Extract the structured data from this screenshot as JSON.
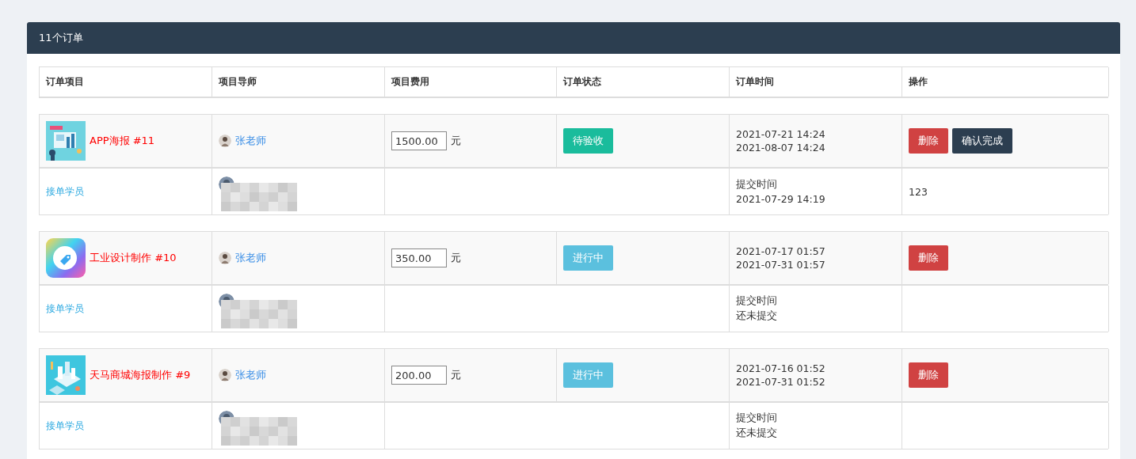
{
  "panel": {
    "title": "11个订单"
  },
  "table": {
    "columns": [
      "订单项目",
      "项目导师",
      "项目费用",
      "订单状态",
      "订单时间",
      "操作"
    ],
    "orders": [
      {
        "title": "APP海报 #11",
        "mentor": "张老师",
        "fee": "1500.00",
        "unit": "元",
        "status": {
          "kind": "pending",
          "label": "待验收"
        },
        "times": [
          "2021-07-21 14:24",
          "2021-08-07 14:24"
        ],
        "actions": [
          {
            "kind": "delete",
            "label": "删除"
          },
          {
            "kind": "confirm",
            "label": "确认完成"
          }
        ],
        "student_label": "接单学员",
        "submit_label": "提交时间",
        "submit_value": "2021-07-29 14:19",
        "remark": "123"
      },
      {
        "title": "工业设计制作 #10",
        "mentor": "张老师",
        "fee": "350.00",
        "unit": "元",
        "status": {
          "kind": "in_progress",
          "label": "进行中"
        },
        "times": [
          "2021-07-17 01:57",
          "2021-07-31 01:57"
        ],
        "actions": [
          {
            "kind": "delete",
            "label": "删除"
          }
        ],
        "student_label": "接单学员",
        "submit_label": "提交时间",
        "submit_value": "还未提交"
      },
      {
        "title": "天马商城海报制作 #9",
        "mentor": "张老师",
        "fee": "200.00",
        "unit": "元",
        "status": {
          "kind": "in_progress",
          "label": "进行中"
        },
        "times": [
          "2021-07-16 01:52",
          "2021-07-31 01:52"
        ],
        "actions": [
          {
            "kind": "delete",
            "label": "删除"
          }
        ],
        "student_label": "接单学员",
        "submit_label": "提交时间",
        "submit_value": "还未提交"
      }
    ]
  }
}
